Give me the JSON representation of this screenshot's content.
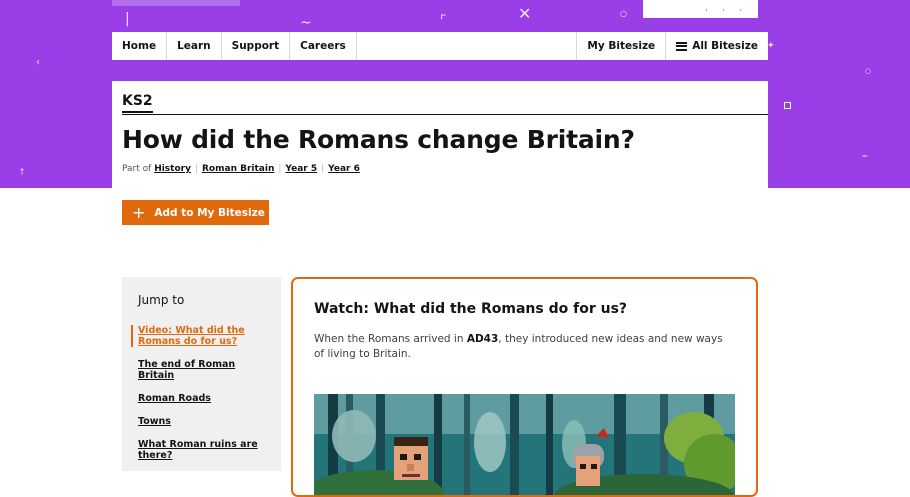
{
  "nav": {
    "items": [
      "Home",
      "Learn",
      "Support",
      "Careers"
    ],
    "my_bitesize": "My Bitesize",
    "all_bitesize": "All Bitesize"
  },
  "header": {
    "level": "KS2",
    "title": "How did the Romans change Britain?",
    "part_of_label": "Part of",
    "breadcrumbs": [
      "History",
      "Roman Britain",
      "Year 5",
      "Year 6"
    ]
  },
  "add_button": {
    "label": "Add to My Bitesize",
    "icon": "plus-icon"
  },
  "jump_to": {
    "title": "Jump to",
    "items": [
      "Video: What did the Romans do for us?",
      "The end of Roman Britain",
      "Roman Roads",
      "Towns",
      "What Roman ruins are there?"
    ]
  },
  "video": {
    "title": "Watch: What did the Romans do for us?",
    "desc_before": "When the Romans arrived in ",
    "desc_bold": "AD43",
    "desc_after": ", they introduced new ideas and new ways of living to Britain."
  },
  "colors": {
    "purple": "#9a3ee8",
    "orange": "#e1690d",
    "text": "#141414",
    "panel": "#f0f0f0"
  }
}
